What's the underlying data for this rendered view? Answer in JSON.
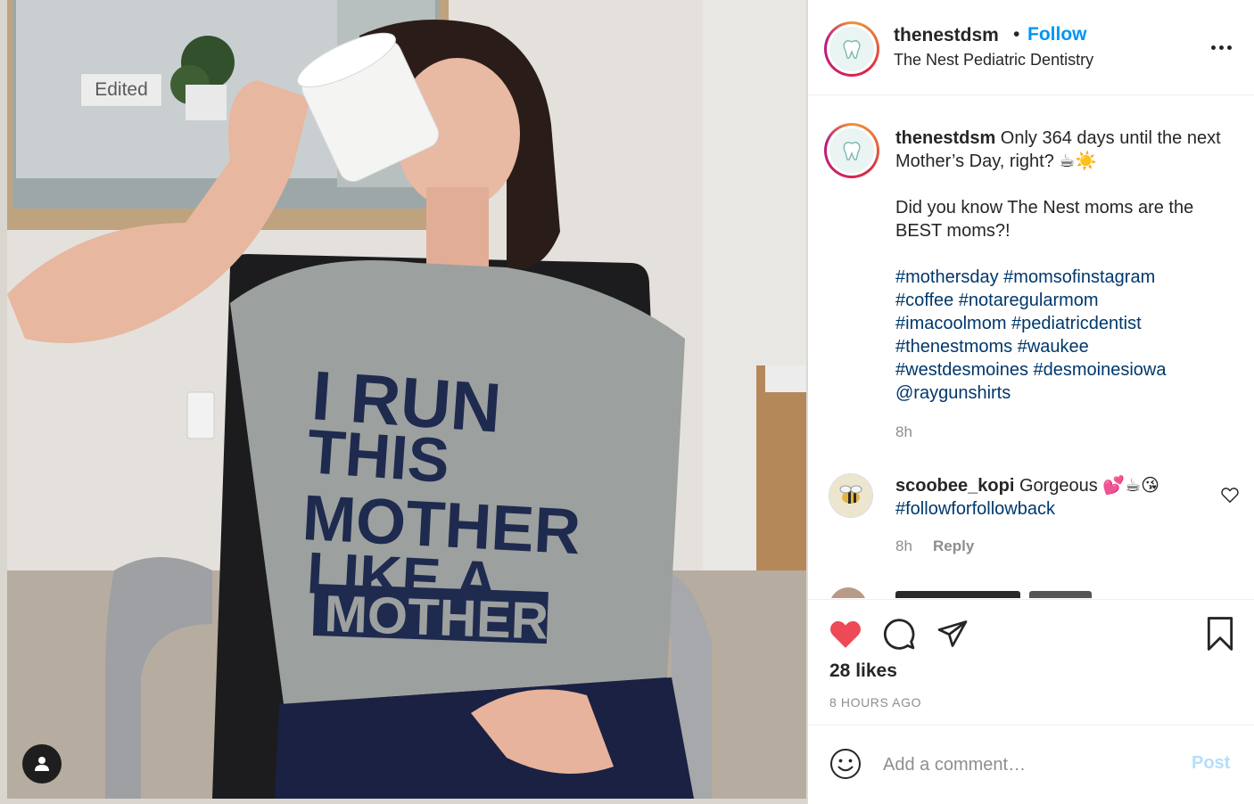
{
  "photo": {
    "edited_label": "Edited",
    "shirt_lines": [
      "I RUN",
      "THIS",
      "MOTHER",
      "LIKE A",
      "MOTHER"
    ],
    "tag_icon": "user-icon"
  },
  "header": {
    "username": "thenestdsm",
    "separator": "•",
    "follow_label": "Follow",
    "subtitle": "The Nest Pediatric Dentistry",
    "more_icon": "more-options-icon"
  },
  "caption": {
    "username": "thenestdsm",
    "line1": " Only 364 days until the next Mother’s Day, right? ☕☀️",
    "line2": "Did you know The Nest moms are the BEST moms?!",
    "hashtags": "#mothersday #momsofinstagram\n#coffee #notaregularmom\n#imacoolmom #pediatricdentist\n#thenestmoms #waukee\n#westdesmoines #desmoinesiowa\n@raygunshirts",
    "time": "8h"
  },
  "comment": {
    "username": "scoobee_kopi",
    "text": " Gorgeous 💕☕😘",
    "hashtag": "#followforfollowback",
    "time": "8h",
    "reply_label": "Reply"
  },
  "actions": {
    "likes": "28 likes",
    "ago": "8 HOURS AGO",
    "like_color": "#ed4956"
  },
  "add_comment": {
    "placeholder": "Add a comment…",
    "post_label": "Post"
  },
  "colors": {
    "link": "#0095f6",
    "hashtag": "#00376b",
    "muted": "#8e8e8e"
  }
}
